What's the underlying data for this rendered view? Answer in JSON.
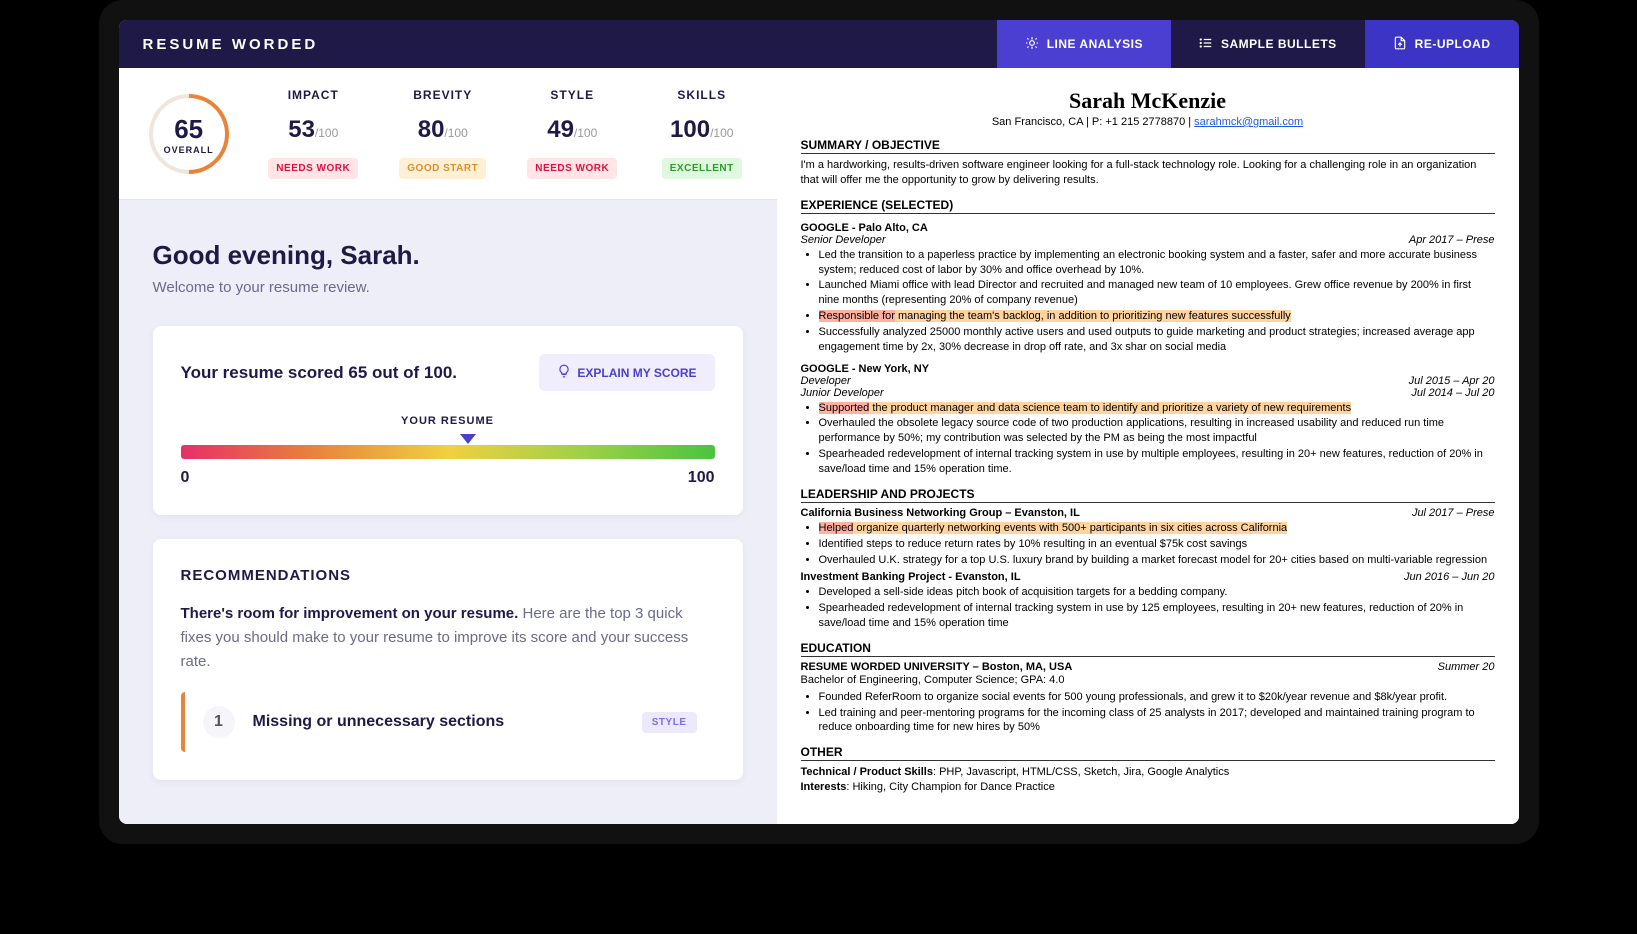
{
  "logo": "RESUME WORDED",
  "nav": {
    "line": "LINE ANALYSIS",
    "sample": "SAMPLE BULLETS",
    "reupload": "RE-UPLOAD"
  },
  "overall": {
    "score": "65",
    "label": "OVERALL"
  },
  "metrics": [
    {
      "name": "IMPACT",
      "score": "53",
      "denom": "/100",
      "status": "NEEDS WORK",
      "cls": "status-needs"
    },
    {
      "name": "BREVITY",
      "score": "80",
      "denom": "/100",
      "status": "GOOD START",
      "cls": "status-good"
    },
    {
      "name": "STYLE",
      "score": "49",
      "denom": "/100",
      "status": "NEEDS WORK",
      "cls": "status-needs"
    },
    {
      "name": "SKILLS",
      "score": "100",
      "denom": "/100",
      "status": "EXCELLENT",
      "cls": "status-excellent"
    }
  ],
  "greeting": "Good evening, Sarah.",
  "subgreeting": "Welcome to your resume review.",
  "scoretext": "Your resume scored 65 out of 100.",
  "explain": "EXPLAIN MY SCORE",
  "resumeLabel": "YOUR RESUME",
  "barMin": "0",
  "barMax": "100",
  "recTitle": "RECOMMENDATIONS",
  "recIntroStrong": "There's room for improvement on your resume.",
  "recIntroText": " Here are the top 3 quick fixes you should make to your resume to improve its score and your success rate.",
  "rec1": {
    "num": "1",
    "title": "Missing or unnecessary sections",
    "badge": "STYLE"
  },
  "resume": {
    "name": "Sarah McKenzie",
    "contact": "San Francisco, CA | P: +1 215 2778870 | ",
    "email": "sarahmck@gmail.com",
    "sections": {
      "summary": "SUMMARY / OBJECTIVE",
      "summaryText": "I'm a hardworking, results-driven software engineer looking for a full-stack technology role. Looking for a challenging role in an organization that will offer me the opportunity to grow by delivering results.",
      "exp": "EXPERIENCE (SELECTED)",
      "job1": "GOOGLE - Palo Alto, CA",
      "job1role": "Senior Developer",
      "job1date": "Apr 2017 – Prese",
      "job1b1": "Led the transition to a paperless practice by implementing an electronic booking system and a faster, safer and more accurate business system; reduced cost of labor by 30% and office overhead by 10%.",
      "job1b2": "Launched Miami office with lead Director and recruited and managed new team of 10 employees. Grew office revenue by 200% in first nine months (representing 20% of company revenue)",
      "job1b3a": "Responsible for",
      "job1b3b": " managing the team's backlog, in addition to prioritizing new features successfully",
      "job1b4": "Successfully analyzed 25000 monthly active users and used outputs to guide marketing and product strategies; increased average app engagement time by 2x, 30% decrease in drop off rate, and 3x shar on social media",
      "job2": "GOOGLE - New York, NY",
      "job2role1": "Developer",
      "job2date1": "Jul 2015 – Apr 20",
      "job2role2": "Junior Developer",
      "job2date2": "Jul 2014 – Jul 20",
      "job2b1a": "Supported",
      "job2b1b": " the product manager and data science team to identify and prioritize a variety of new requirements",
      "job2b2": "Overhauled the obsolete legacy source code of two production applications, resulting in increased usability and reduced run time performance by 50%; my contribution was selected by the PM as being the most impactful",
      "job2b3": "Spearheaded redevelopment of internal tracking system in use by multiple employees, resulting in 20+ new features, reduction of 20% in save/load time and 15% operation time.",
      "lead": "LEADERSHIP AND PROJECTS",
      "lead1": "California Business Networking Group – Evanston, IL",
      "lead1date": "Jul 2017 – Prese",
      "lead1b1a": "Helped",
      "lead1b1b": " organize quarterly networking events with 500+ participants in six cities across California",
      "lead1b2": "Identified steps to reduce return rates by 10% resulting in an eventual $75k cost savings",
      "lead1b3": "Overhauled U.K. strategy for a top U.S. luxury brand by building a market forecast model for 20+ cities based on multi-variable regression",
      "lead2": "Investment Banking Project - Evanston, IL",
      "lead2date": "Jun 2016 – Jun 20",
      "lead2b1": "Developed a sell-side ideas pitch book of acquisition targets for a bedding company.",
      "lead2b2": "Spearheaded redevelopment of internal tracking system in use by 125 employees, resulting in 20+ new features, reduction of 20% in save/load time and 15% operation time",
      "edu": "EDUCATION",
      "edu1": "RESUME WORDED UNIVERSITY – Boston, MA, USA",
      "edu1date": "Summer 20",
      "edu1sub": "Bachelor of Engineering, Computer Science; GPA: 4.0",
      "edu1b1": "Founded ReferRoom to organize social events for 500 young professionals, and grew it to $20k/year revenue and $8k/year profit.",
      "edu1b2": "Led training and peer-mentoring programs for the incoming class of 25 analysts in 2017; developed and maintained training program to reduce onboarding time for new hires by 50%",
      "other": "OTHER",
      "otherSkills": "Technical / Product Skills",
      "otherSkillsText": ": PHP, Javascript, HTML/CSS, Sketch, Jira, Google Analytics",
      "otherInterests": "Interests",
      "otherInterestsText": ": Hiking, City Champion for Dance Practice"
    }
  }
}
